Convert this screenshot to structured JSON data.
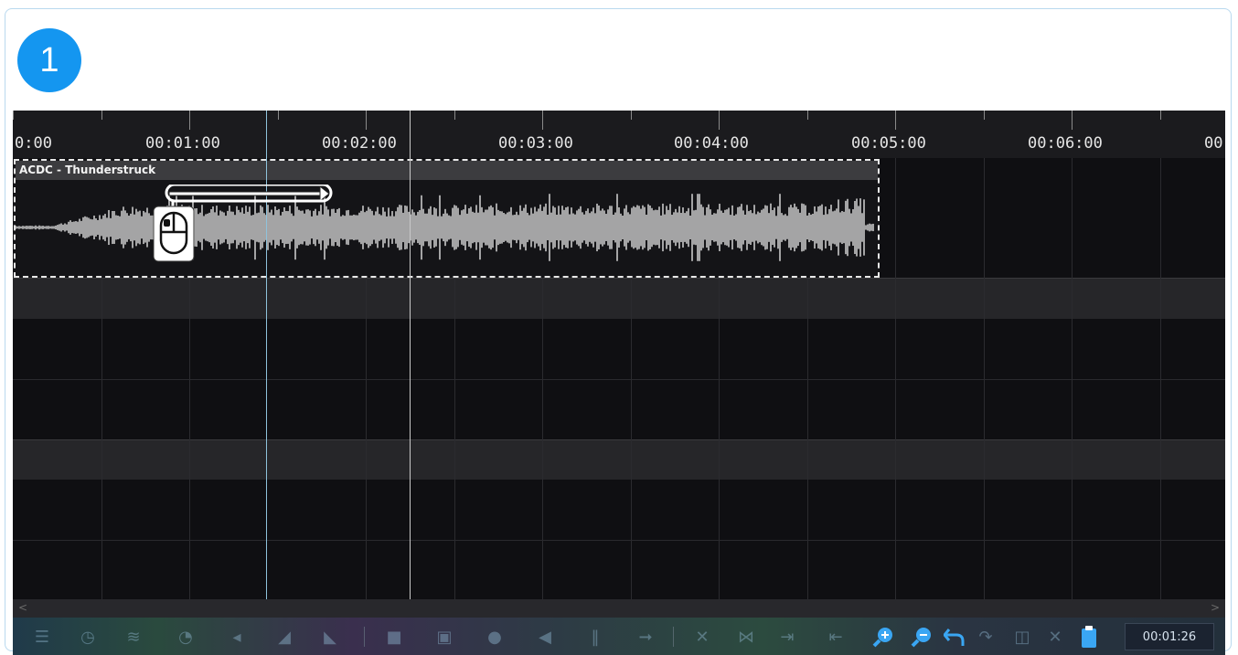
{
  "step_badge": "1",
  "ruler": {
    "labels": [
      "0:00",
      "00:01:00",
      "00:02:00",
      "00:03:00",
      "00:04:00",
      "00:05:00",
      "00:06:00",
      "00"
    ]
  },
  "clip": {
    "title": "ACDC - Thunderstruck"
  },
  "hint": {
    "icon": "mouse-drag-icon",
    "direction": "right"
  },
  "toolbar": {
    "icons": [
      "mixer-icon",
      "clock-icon",
      "waveform-icon",
      "speed-icon",
      "volume-icon",
      "fade-in-icon",
      "fade-out-icon",
      "delete-icon",
      "trash-icon",
      "record-voice-icon",
      "mute-icon",
      "split-icon",
      "move-right-icon",
      "cut-icon",
      "cut-selection-icon",
      "trim-end-icon",
      "trim-start-icon",
      "zoom-in-icon",
      "zoom-out-icon",
      "undo-icon",
      "redo-icon",
      "copy-icon",
      "close-icon",
      "paste-icon"
    ],
    "time": "00:01:26",
    "accent": "#3aa6f3"
  },
  "colors": {
    "badge": "#1496f0",
    "playhead": "#8fc3dc"
  }
}
